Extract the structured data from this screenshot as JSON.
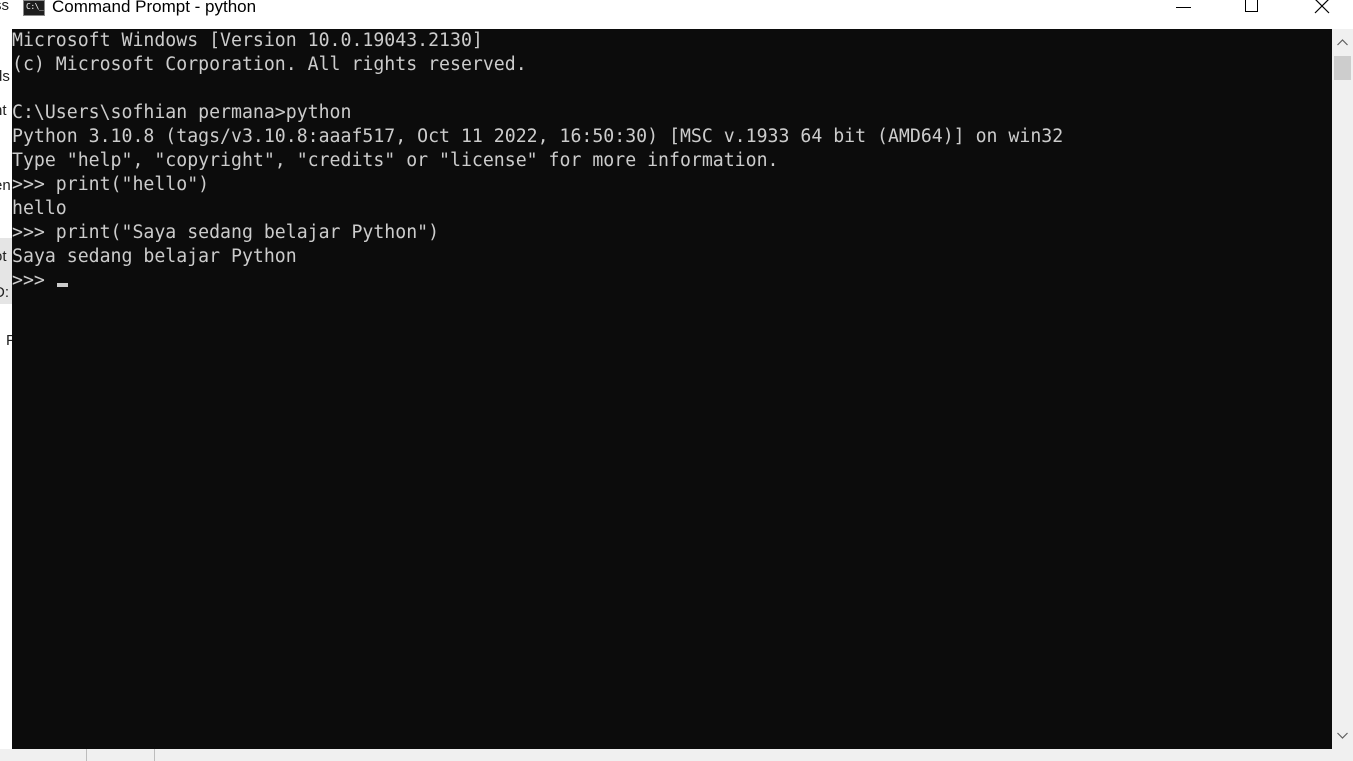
{
  "background_window": {
    "fragments": [
      "ss",
      "ds",
      "nt",
      "en",
      "ot",
      "D:",
      "P"
    ]
  },
  "window": {
    "title": "Command Prompt - python",
    "icon": "cmd-app-icon",
    "buttons": {
      "minimize": "minimize-icon",
      "maximize": "maximize-icon",
      "close": "close-icon"
    }
  },
  "console": {
    "background": "#0c0c0c",
    "foreground": "#cccccc",
    "lines": [
      "Microsoft Windows [Version 10.0.19043.2130]",
      "(c) Microsoft Corporation. All rights reserved.",
      "",
      "C:\\Users\\sofhian permana>python",
      "Python 3.10.8 (tags/v3.10.8:aaaf517, Oct 11 2022, 16:50:30) [MSC v.1933 64 bit (AMD64)] on win32",
      "Type \"help\", \"copyright\", \"credits\" or \"license\" for more information.",
      ">>> print(\"hello\")",
      "hello",
      ">>> print(\"Saya sedang belajar Python\")",
      "Saya sedang belajar Python"
    ],
    "prompt": ">>> "
  },
  "scrollbar": {
    "up_icon": "scroll-up-arrow-icon",
    "down_icon": "scroll-down-arrow-icon"
  }
}
